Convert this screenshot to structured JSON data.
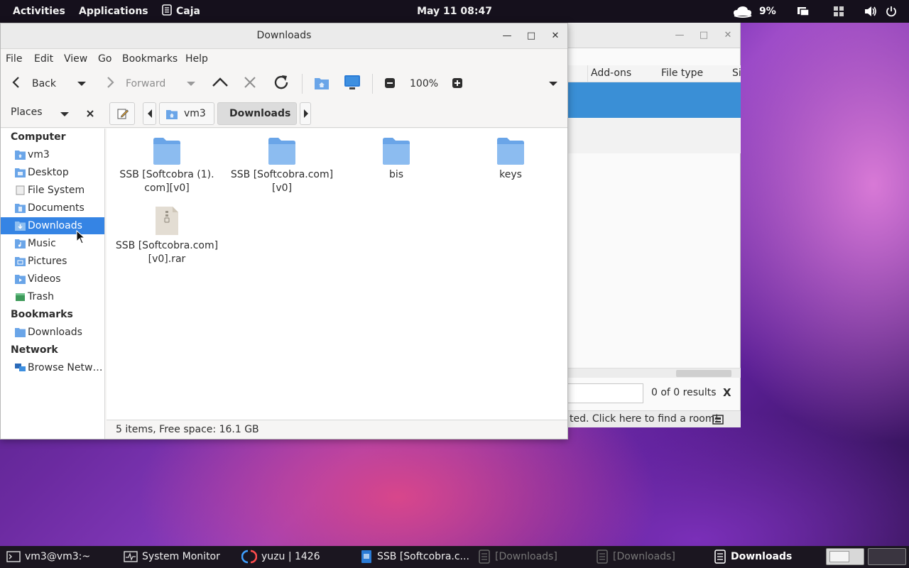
{
  "topbar": {
    "activities": "Activities",
    "applications": "Applications",
    "app_name": "Caja",
    "clock": "May 11  08:47",
    "weather_percent": "9%"
  },
  "bg_window": {
    "columns": [
      "Add-ons",
      "File type",
      "Si"
    ],
    "results": "0 of 0 results",
    "close_search": "X",
    "status": "ted. Click here to find a room!"
  },
  "window": {
    "title": "Downloads",
    "menu": [
      "File",
      "Edit",
      "View",
      "Go",
      "Bookmarks",
      "Help"
    ],
    "toolbar": {
      "back": "Back",
      "forward": "Forward",
      "zoom": "100%"
    },
    "places_label": "Places",
    "breadcrumb": [
      "vm3",
      "Downloads"
    ],
    "sidebar": {
      "computer_header": "Computer",
      "computer_items": [
        "vm3",
        "Desktop",
        "File System",
        "Documents",
        "Downloads",
        "Music",
        "Pictures",
        "Videos",
        "Trash"
      ],
      "bookmarks_header": "Bookmarks",
      "bookmark_items": [
        "Downloads"
      ],
      "network_header": "Network",
      "network_items": [
        "Browse Netw…"
      ]
    },
    "files": [
      {
        "name_l1": "SSB [Softcobra (1).",
        "name_l2": "com][v0]",
        "type": "folder"
      },
      {
        "name_l1": "SSB [Softcobra.com]",
        "name_l2": "[v0]",
        "type": "folder"
      },
      {
        "name_l1": "bis",
        "name_l2": "",
        "type": "folder"
      },
      {
        "name_l1": "keys",
        "name_l2": "",
        "type": "folder"
      },
      {
        "name_l1": "SSB [Softcobra.com]",
        "name_l2": "[v0].rar",
        "type": "archive"
      }
    ],
    "status": "5 items, Free space: 16.1 GB"
  },
  "taskbar": {
    "items": [
      "vm3@vm3:~",
      "System Monitor",
      "yuzu | 1426",
      "SSB [Softcobra.c...",
      "[Downloads]",
      "[Downloads]",
      "Downloads"
    ]
  },
  "colors": {
    "accent": "#3584e4",
    "folder": "#6aa5e8",
    "topbar_bg": "#15101c"
  }
}
